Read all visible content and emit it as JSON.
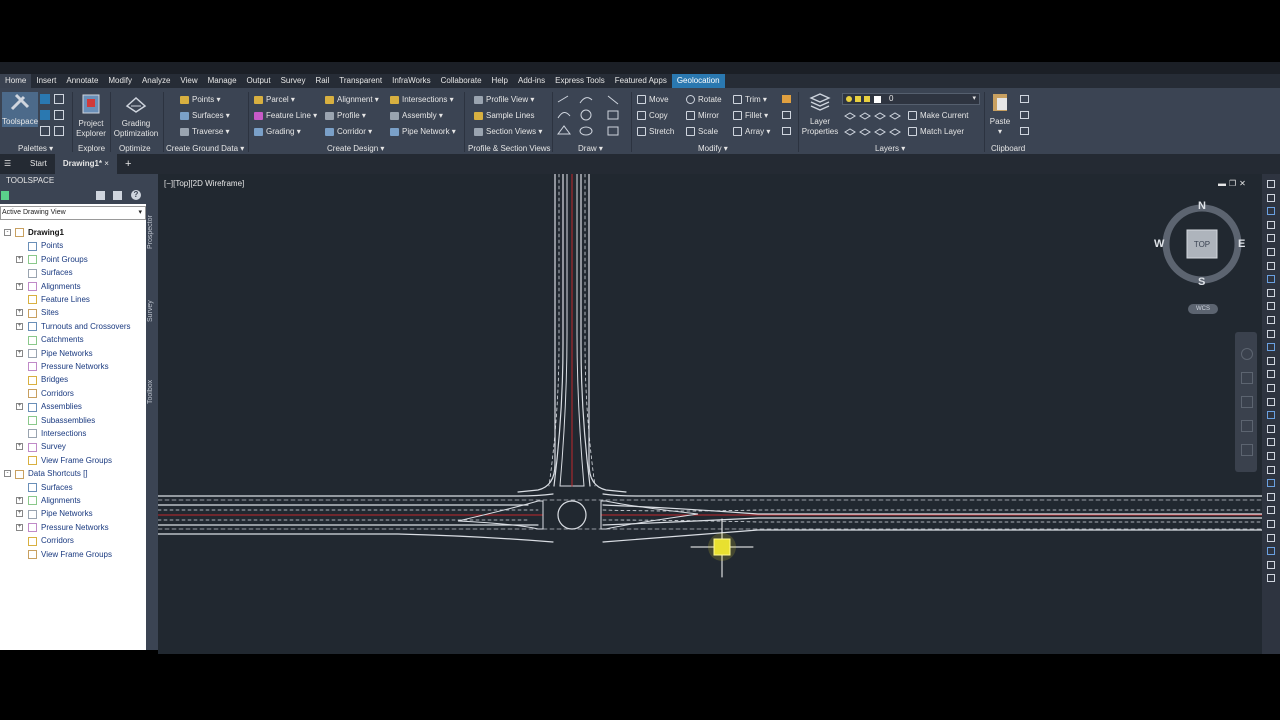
{
  "menubar": {
    "tabs": [
      "Home",
      "Insert",
      "Annotate",
      "Modify",
      "Analyze",
      "View",
      "Manage",
      "Output",
      "Survey",
      "Rail",
      "Transparent",
      "InfraWorks",
      "Collaborate",
      "Help",
      "Add-ins",
      "Express Tools",
      "Featured Apps",
      "Geolocation"
    ],
    "active": "Home",
    "highlight": "Geolocation"
  },
  "ribbon": {
    "palettes": {
      "toolspace": "Toolspace",
      "label": "Palettes"
    },
    "explore": {
      "project_explorer_line1": "Project",
      "project_explorer_line2": "Explorer",
      "label": "Explore"
    },
    "optimize": {
      "grading_line1": "Grading",
      "grading_line2": "Optimization",
      "label": "Optimize"
    },
    "ground": {
      "points": "Points",
      "surfaces": "Surfaces",
      "traverse": "Traverse",
      "label": "Create Ground Data"
    },
    "design": {
      "parcel": "Parcel",
      "feature_line": "Feature Line",
      "grading": "Grading",
      "alignment": "Alignment",
      "profile": "Profile",
      "corridor": "Corridor",
      "intersections": "Intersections",
      "assembly": "Assembly",
      "pipe_network": "Pipe Network",
      "label": "Create Design"
    },
    "profile_views": {
      "profile_view": "Profile View",
      "sample_lines": "Sample Lines",
      "section_views": "Section Views",
      "label": "Profile & Section Views"
    },
    "draw": {
      "label": "Draw"
    },
    "modify": {
      "move": "Move",
      "copy": "Copy",
      "stretch": "Stretch",
      "rotate": "Rotate",
      "mirror": "Mirror",
      "scale": "Scale",
      "trim": "Trim",
      "fillet": "Fillet",
      "array": "Array",
      "label": "Modify"
    },
    "layers": {
      "layer_props_line1": "Layer",
      "layer_props_line2": "Properties",
      "layer_value": "0",
      "make_current": "Make Current",
      "match_layer": "Match Layer",
      "label": "Layers"
    },
    "clipboard": {
      "paste": "Paste",
      "label": "Clipboard"
    }
  },
  "filetabs": {
    "start": "Start",
    "drawing": "Drawing1*",
    "close": "×",
    "new": "+"
  },
  "toolspace": {
    "title": "TOOLSPACE",
    "view_mode": "Active Drawing View",
    "tree": [
      {
        "label": "Drawing1",
        "level": 0,
        "bold": true,
        "exp": "-"
      },
      {
        "label": "Points",
        "level": 1,
        "exp": ""
      },
      {
        "label": "Point Groups",
        "level": 1,
        "exp": "+"
      },
      {
        "label": "Surfaces",
        "level": 1,
        "exp": ""
      },
      {
        "label": "Alignments",
        "level": 1,
        "exp": "+"
      },
      {
        "label": "Feature Lines",
        "level": 1,
        "exp": ""
      },
      {
        "label": "Sites",
        "level": 1,
        "exp": "+"
      },
      {
        "label": "Turnouts and Crossovers",
        "level": 1,
        "exp": "+"
      },
      {
        "label": "Catchments",
        "level": 1,
        "exp": ""
      },
      {
        "label": "Pipe Networks",
        "level": 1,
        "exp": "+"
      },
      {
        "label": "Pressure Networks",
        "level": 1,
        "exp": ""
      },
      {
        "label": "Bridges",
        "level": 1,
        "exp": ""
      },
      {
        "label": "Corridors",
        "level": 1,
        "exp": ""
      },
      {
        "label": "Assemblies",
        "level": 1,
        "exp": "+"
      },
      {
        "label": "Subassemblies",
        "level": 1,
        "exp": ""
      },
      {
        "label": "Intersections",
        "level": 1,
        "exp": ""
      },
      {
        "label": "Survey",
        "level": 1,
        "exp": "+"
      },
      {
        "label": "View Frame Groups",
        "level": 1,
        "exp": ""
      },
      {
        "label": "Data Shortcuts []",
        "level": 0,
        "exp": "-"
      },
      {
        "label": "Surfaces",
        "level": 1,
        "exp": ""
      },
      {
        "label": "Alignments",
        "level": 1,
        "exp": "+"
      },
      {
        "label": "Pipe Networks",
        "level": 1,
        "exp": "+"
      },
      {
        "label": "Pressure Networks",
        "level": 1,
        "exp": "+"
      },
      {
        "label": "Corridors",
        "level": 1,
        "exp": ""
      },
      {
        "label": "View Frame Groups",
        "level": 1,
        "exp": ""
      }
    ]
  },
  "sidetabs": {
    "prospector": "Prospector",
    "survey": "Survey",
    "toolbox": "Toolbox"
  },
  "viewport": {
    "view_label": "[−][Top][2D Wireframe]"
  },
  "viewcube": {
    "n": "N",
    "s": "S",
    "e": "E",
    "w": "W",
    "top": "TOP",
    "wcs": "WCS"
  },
  "colors": {
    "road_edge": "#d9dde3",
    "centerline": "#c0272d",
    "cursor": "#e8e030",
    "bg": "#212830"
  }
}
